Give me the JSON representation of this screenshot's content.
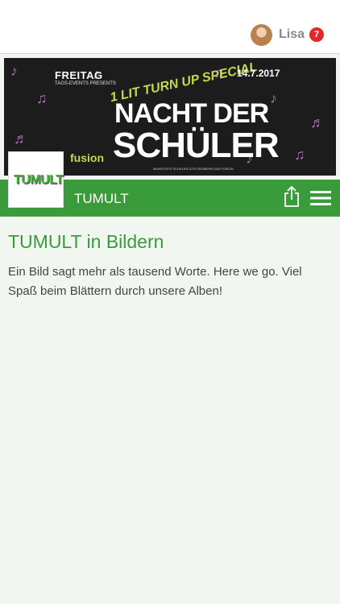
{
  "header": {
    "user_name": "Lisa",
    "notification_count": "7"
  },
  "banner": {
    "day": "FREITAG",
    "presenter": "TAGS-EVENTS PRESENTS",
    "special": "1 LIT TURN UP SPECIAL",
    "date": "14.7.2017",
    "title_line1": "NACHT DER",
    "title_line2": "SCHÜLER",
    "venue": "fusion",
    "subtitle": "MÜNSTER'S SCHÜLER-DJ'S EROBERN DAS FUSION"
  },
  "club": {
    "logo_text": "TUMULT",
    "name": "TUMULT"
  },
  "content": {
    "title": "TUMULT in Bildern",
    "description": "Ein Bild sagt mehr als tausend Worte. Here we go. Viel Spaß beim Blättern durch unsere Alben!"
  },
  "colors": {
    "brand_green": "#3a9b3a",
    "badge_red": "#e3262a"
  },
  "icons": [
    "share-icon",
    "hamburger-menu-icon"
  ]
}
